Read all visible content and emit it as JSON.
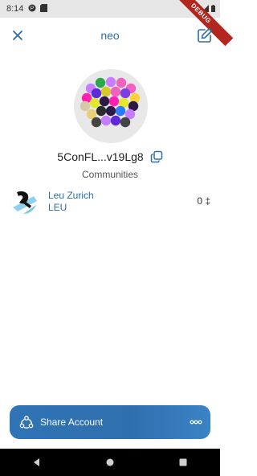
{
  "status_bar": {
    "time": "8:14",
    "debug_label": "DEBUG"
  },
  "app_bar": {
    "title": "neo"
  },
  "account": {
    "address": "5ConFL...v19Lg8"
  },
  "identicon": {
    "dots": [
      {
        "color": "#c77dff"
      },
      {
        "color": "#2aa84a"
      },
      {
        "color": "#c77dff"
      },
      {
        "color": "#f062c0"
      },
      {
        "color": "#f062c0"
      },
      {
        "color": "#ff1fb2"
      },
      {
        "color": "#5b2bd6"
      },
      {
        "color": "#d9c82b"
      },
      {
        "color": "#f062c0"
      },
      {
        "color": "#7a3fe0"
      },
      {
        "color": "#ffd23d"
      },
      {
        "color": "#d9c8a8"
      },
      {
        "color": "#e2e82b"
      },
      {
        "color": "#2b1a45"
      },
      {
        "color": "#ff1fb2"
      },
      {
        "color": "#e8e82b"
      },
      {
        "color": "#2b1a45"
      },
      {
        "color": "#e8d07b"
      },
      {
        "color": "#2b2b2b"
      },
      {
        "color": "#2b1a45"
      },
      {
        "color": "#2b7bff"
      },
      {
        "color": "#c77dff"
      },
      {
        "color": "#444444"
      },
      {
        "color": "#c77dff"
      },
      {
        "color": "#5b2bd6"
      },
      {
        "color": "#444444"
      }
    ]
  },
  "communities": {
    "label": "Communities",
    "items": [
      {
        "name": "Leu Zurich",
        "symbol": "LEU",
        "balance": "0 ‡"
      }
    ]
  },
  "share": {
    "label": "Share Account"
  },
  "colors": {
    "accent": "#2d6ea5",
    "share_bar": "#2f74b5"
  }
}
